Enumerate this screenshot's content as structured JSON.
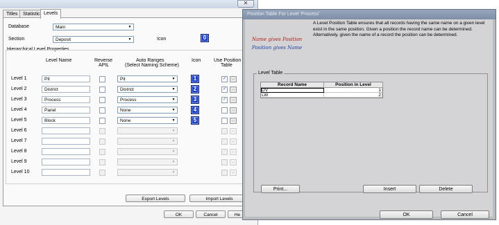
{
  "back": {
    "tabs": [
      "Titles",
      "Statistics",
      "Levels"
    ],
    "database_label": "Database",
    "database_value": "Main",
    "section_label": "Section",
    "section_value": "Deposit",
    "icon_label": "Icon",
    "section_icon": "0",
    "group_title": "Hierarchical Level Properties",
    "headers": {
      "level_name": "Level Name",
      "reverse_apil_1": "Reverse",
      "reverse_apil_2": "APIL",
      "auto_ranges_1": "Auto Ranges",
      "auto_ranges_2": "(Select Naming Scheme)",
      "icon": "Icon",
      "use_position_1": "Use Position",
      "use_position_2": "Table"
    },
    "levels": [
      {
        "label": "Level 1",
        "name": "Pit",
        "scheme": "Pit",
        "icon": "1",
        "use_pos": true
      },
      {
        "label": "Level 2",
        "name": "District",
        "scheme": "District",
        "icon": "2",
        "use_pos": true
      },
      {
        "label": "Level 3",
        "name": "Process",
        "scheme": "Process",
        "icon": "3",
        "use_pos": true
      },
      {
        "label": "Level 4",
        "name": "Panel",
        "scheme": "None",
        "icon": "4",
        "use_pos": false
      },
      {
        "label": "Level 5",
        "name": "Block",
        "scheme": "None",
        "icon": "5",
        "use_pos": false
      },
      {
        "label": "Level 6",
        "name": "",
        "scheme": "",
        "icon": "",
        "use_pos": false
      },
      {
        "label": "Level 7",
        "name": "",
        "scheme": "",
        "icon": "",
        "use_pos": false
      },
      {
        "label": "Level 8",
        "name": "",
        "scheme": "",
        "icon": "",
        "use_pos": false
      },
      {
        "label": "Level 9",
        "name": "",
        "scheme": "",
        "icon": "",
        "use_pos": false
      },
      {
        "label": "Level 10",
        "name": "",
        "scheme": "",
        "icon": "",
        "use_pos": false
      }
    ],
    "export_levels": "Export Levels",
    "import_levels": "Import Levels",
    "ok": "OK",
    "cancel": "Cancel",
    "help": "He"
  },
  "front": {
    "title": "Position Table For Level 'Process'",
    "logo_line1": "Name gives Position",
    "logo_line2": "Position gives Name",
    "description": "A Level Position Table ensures that all records having the same name on a given level exist in the same position.  Given a position the record name can be determined.  Alternatively, given the name of a record the position can be determined.",
    "group_title": "Level Table",
    "col_record": "Record Name",
    "col_position": "Position in Level",
    "rows": [
      {
        "name": "DV",
        "position": "1"
      },
      {
        "name": "LW",
        "position": "2"
      }
    ],
    "print": "Print...",
    "insert": "Insert",
    "delete": "Delete",
    "ok": "OK",
    "cancel": "Cancel"
  }
}
